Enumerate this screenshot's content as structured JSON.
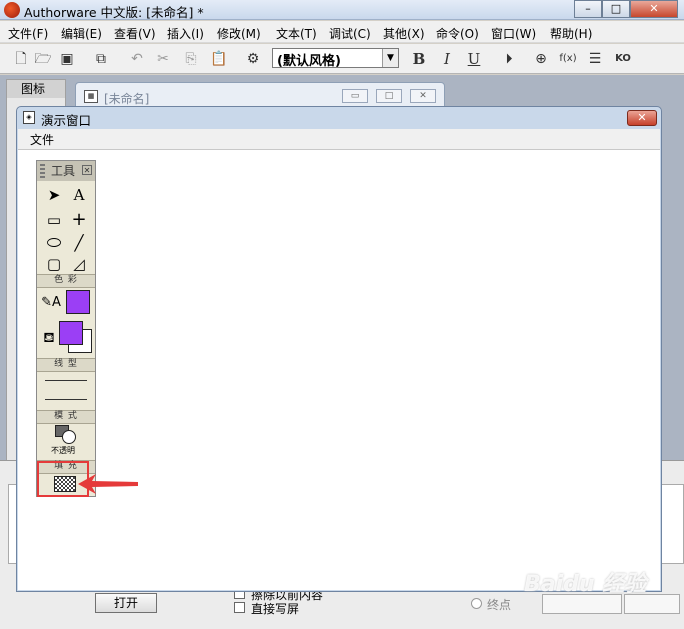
{
  "window": {
    "title": "Authorware 中文版: [未命名] *",
    "buttons": [
      "–",
      "□",
      "✕"
    ]
  },
  "menubar": {
    "items": [
      "文件(F)",
      "编辑(E)",
      "查看(V)",
      "插入(I)",
      "修改(M)",
      "文本(T)",
      "调试(C)",
      "其他(X)",
      "命令(O)",
      "窗口(W)",
      "帮助(H)"
    ]
  },
  "toolbar": {
    "style_select": "(默认风格)",
    "bold_label": "B",
    "italic_label": "I",
    "underline_label": "U"
  },
  "icons_panel": {
    "title": "图标"
  },
  "flow_window": {
    "title": "[未命名]"
  },
  "presentation_window": {
    "title": "演示窗口",
    "menu_file": "文件",
    "close_label": "✕"
  },
  "tool_palette": {
    "title": "工具",
    "section_color": "色 彩",
    "section_line": "线 型",
    "section_mode": "模 式",
    "mode_value": "不透明",
    "section_fill": "填 充",
    "fill_color": "#9b3ff5",
    "highlight_color": "#e53a3a"
  },
  "properties": {
    "open_button": "打开",
    "check_erase": "擦除以前内容",
    "check_direct": "直接写屏",
    "radio_end": "终点"
  },
  "watermark": "Baidu 经验"
}
